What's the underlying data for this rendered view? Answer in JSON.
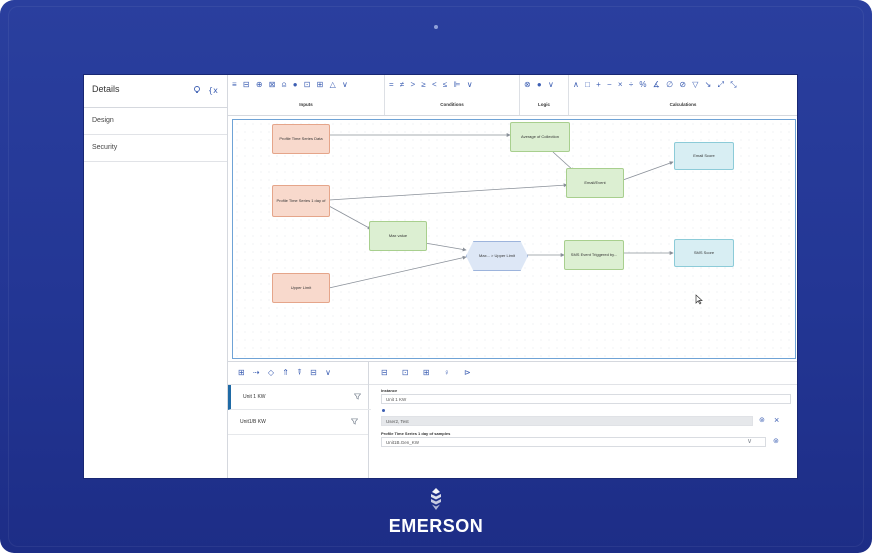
{
  "device": {
    "brand": "EMERSON"
  },
  "details": {
    "title": "Details",
    "nav": [
      {
        "label": "Design"
      },
      {
        "label": "Security"
      }
    ]
  },
  "toolbar": {
    "groups": [
      {
        "label": "Inputs",
        "glyphs": "≡ ⊟ ⊕ ⊠ ⍝ ● ⊡ ⊞ △ ∨"
      },
      {
        "label": "Conditions",
        "glyphs": "= ≠ > ≥ < ≤ ⊫ ∨"
      },
      {
        "label": "Logic",
        "glyphs": "⊗ ● ∨"
      },
      {
        "label": "Calculations",
        "glyphs": "∧ □ + − × ÷ % ∡ ∅ ⊘ ▽ ↘ ⤢ ⤡"
      }
    ]
  },
  "flow": {
    "nodes": {
      "profile_series_data": "Profile Time Series Data",
      "profile_series_day": "Profile Time Series 1 day of",
      "upper_limit": "Upper Limit",
      "average_collection": "Average of Collection",
      "max_value": "Max value",
      "max_upper": "Max... > Upper Limit",
      "email_event": "Email/Event",
      "sms_event": "SMS Event Triggered by...",
      "email_score": "Email Score",
      "sms_score": "SMS Score"
    },
    "compare_symbol": ">"
  },
  "bottom": {
    "list_tools_glyphs": "⊞ ⇢ ◇ ⇑ ⍒ ⊟ ∨",
    "units": [
      {
        "label": "Unit 1 KW",
        "selected": true
      },
      {
        "label": "Unit1/B KW",
        "selected": false
      }
    ],
    "detail_tools_glyphs": "⊟ ⊡ ⊞ ♀ ⊳",
    "fields": {
      "instance_label": "Instance",
      "instance_value": "Unit 1 KW",
      "user_value": "User2, Test",
      "series_label": "Profile Time Series 1 day of samples",
      "series_value": "Unit1B.Gen_KW"
    }
  },
  "colors": {
    "bezel": "#233694",
    "accent": "#3d5fb3",
    "node_orange": "#f8d9cc",
    "node_green": "#dcefd2",
    "node_teal": "#d8eef3"
  }
}
